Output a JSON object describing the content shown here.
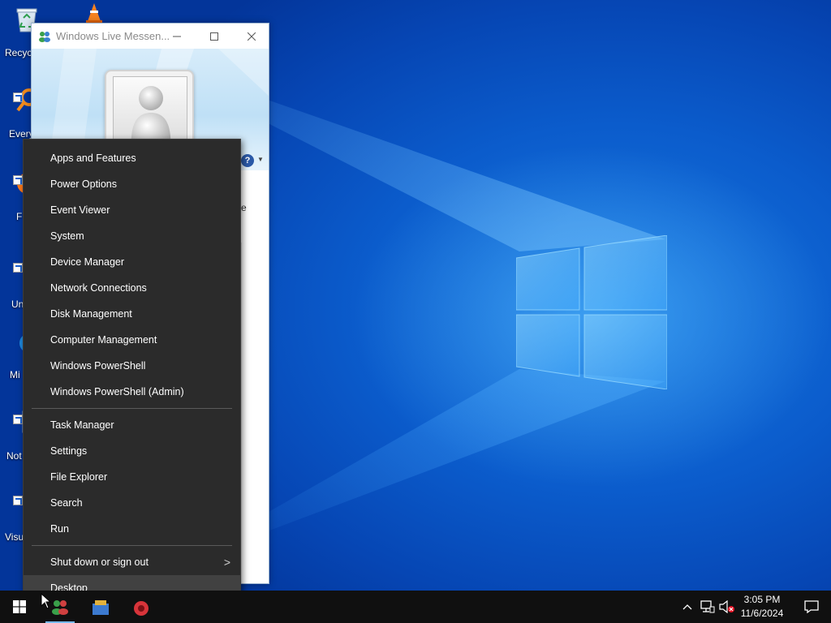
{
  "desktop": {
    "icons": [
      {
        "label": "Recyc"
      },
      {
        "label": "Every"
      },
      {
        "label": "F"
      },
      {
        "label": "Un"
      },
      {
        "label": "Mi"
      },
      {
        "label": "Not"
      },
      {
        "label": "Visu"
      }
    ]
  },
  "messenger_window": {
    "title": "Windows Live Messen...",
    "stray_text": "e",
    "help_label": "?"
  },
  "context_menu": {
    "group1": [
      {
        "label": "Apps and Features"
      },
      {
        "label": "Power Options"
      },
      {
        "label": "Event Viewer"
      },
      {
        "label": "System"
      },
      {
        "label": "Device Manager"
      },
      {
        "label": "Network Connections"
      },
      {
        "label": "Disk Management"
      },
      {
        "label": "Computer Management"
      },
      {
        "label": "Windows PowerShell"
      },
      {
        "label": "Windows PowerShell (Admin)"
      }
    ],
    "group2": [
      {
        "label": "Task Manager"
      },
      {
        "label": "Settings"
      },
      {
        "label": "File Explorer"
      },
      {
        "label": "Search"
      },
      {
        "label": "Run"
      }
    ],
    "group3": [
      {
        "label": "Shut down or sign out",
        "has_submenu": true
      },
      {
        "label": "Desktop",
        "highlighted": true
      }
    ],
    "submenu_glyph": ">"
  },
  "taskbar": {
    "clock_time": "3:05 PM",
    "clock_date": "11/6/2024",
    "tray_icons": [
      "chevron-up-icon",
      "network-icon",
      "volume-muted-icon",
      "action-center-icon"
    ]
  },
  "colors": {
    "menu_bg": "#2b2b2b",
    "menu_hover": "#414141",
    "taskbar_bg": "#101010",
    "wallpaper_blue": "#0b5ccc"
  }
}
